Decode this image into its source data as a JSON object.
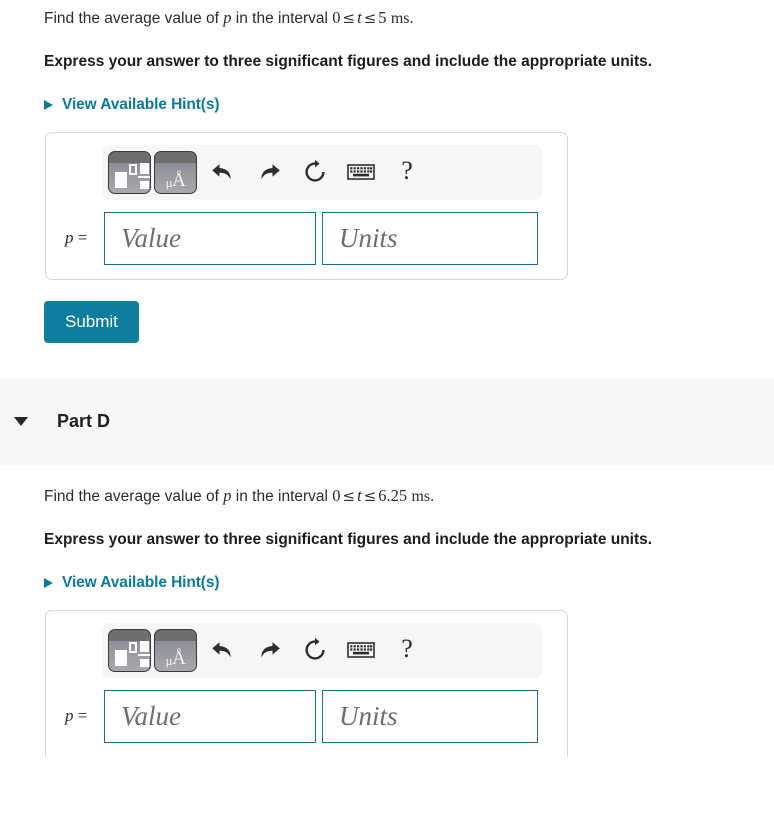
{
  "part_c": {
    "question": {
      "prefix": "Find the average value of ",
      "variable": "p",
      "middle": " in the interval ",
      "lower_bound": "0",
      "rel1": "≤",
      "interval_var": "t",
      "rel2": "≤",
      "upper_bound": "5",
      "unit": "ms",
      "period": "."
    },
    "instruction": "Express your answer to three significant figures and include the appropriate units.",
    "hints_label": "View Available Hint(s)",
    "toolbar": {
      "template_button_title": "math-templates",
      "units_button_label_mu": "μ",
      "units_button_label_angstrom": "Å",
      "undo_title": "undo",
      "redo_title": "redo",
      "reset_title": "reset",
      "keyboard_title": "keyboard",
      "help_label": "?"
    },
    "answer": {
      "var_label_symbol": "p",
      "var_label_equals": " =",
      "value_placeholder": "Value",
      "units_placeholder": "Units"
    },
    "submit_label": "Submit"
  },
  "part_d": {
    "header_title": "Part D",
    "question": {
      "prefix": "Find the average value of ",
      "variable": "p",
      "middle": " in the interval ",
      "lower_bound": "0",
      "rel1": "≤",
      "interval_var": "t",
      "rel2": "≤",
      "upper_bound": "6.25",
      "unit": "ms",
      "period": "."
    },
    "instruction": "Express your answer to three significant figures and include the appropriate units.",
    "hints_label": "View Available Hint(s)",
    "toolbar": {
      "template_button_title": "math-templates",
      "units_button_label_mu": "μ",
      "units_button_label_angstrom": "Å",
      "undo_title": "undo",
      "redo_title": "redo",
      "reset_title": "reset",
      "keyboard_title": "keyboard",
      "help_label": "?"
    },
    "answer": {
      "var_label_symbol": "p",
      "var_label_equals": " =",
      "value_placeholder": "Value",
      "units_placeholder": "Units"
    }
  },
  "colors": {
    "accent_teal": "#0c7a9c",
    "submit_bg": "#0e7d9e",
    "input_border": "#15708f",
    "band_bg": "#f7f7f7",
    "toolbar_bg": "#f6f6f6",
    "card_border": "#d8d8d8"
  }
}
